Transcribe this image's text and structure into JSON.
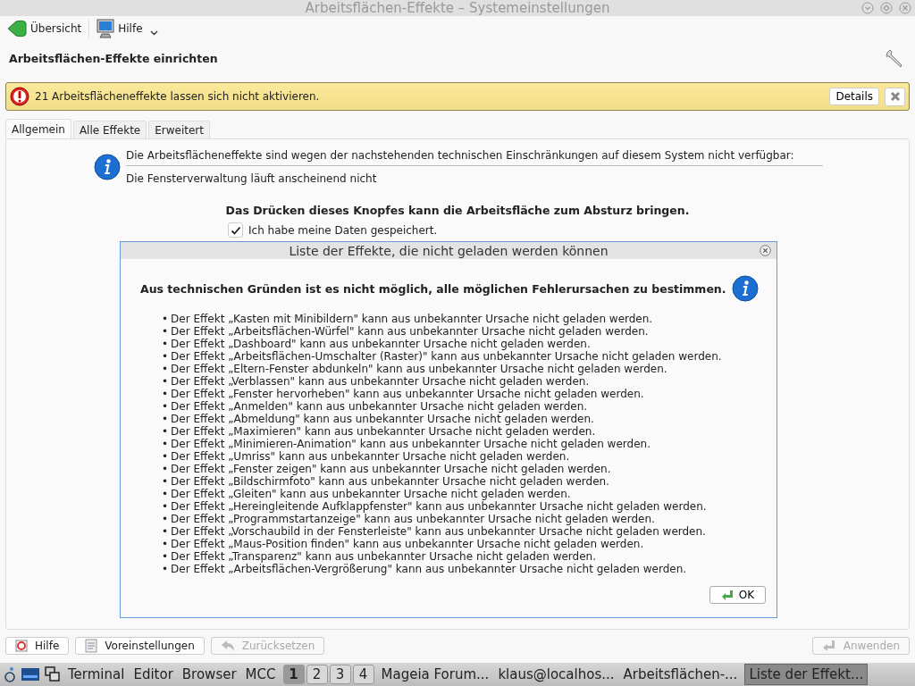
{
  "window": {
    "title": "Arbeitsflächen-Effekte – Systemeinstellungen"
  },
  "toolbar": {
    "items": [
      {
        "kind": "back",
        "label": "Übersicht"
      },
      {
        "kind": "help",
        "label": "Hilfe"
      }
    ]
  },
  "heading": "Arbeitsflächen-Effekte einrichten",
  "banner": {
    "message": "21 Arbeitsflächeneffekte lassen sich nicht aktivieren.",
    "details_button": "Details"
  },
  "tabs": [
    {
      "label": "Allgemein",
      "selected": true
    },
    {
      "label": "Alle Effekte",
      "selected": false
    },
    {
      "label": "Erweitert",
      "selected": false
    }
  ],
  "general": {
    "info_lines": [
      "Die Arbeitsflächeneffekte sind wegen der nachstehenden technischen Einschränkungen auf diesem System nicht verfügbar:",
      "Die Fensterverwaltung läuft anscheinend nicht"
    ],
    "warning": "Das Drücken dieses Knopfes kann die Arbeitsfläche zum Absturz bringen.",
    "confirm": {
      "label": "Ich habe meine Daten gespeichert.",
      "checked": true
    }
  },
  "dialog": {
    "title": "Liste der Effekte, die nicht geladen werden können",
    "heading": "Aus technischen Gründen ist es nicht möglich, alle möglichen Fehlerursachen zu bestimmen.",
    "items": [
      {
        "bullet": "•",
        "text": "Der Effekt „Kasten mit Minibildern\" kann aus unbekannter Ursache nicht geladen werden."
      },
      {
        "bullet": "•",
        "text": "Der Effekt „Arbeitsflächen-Würfel\" kann aus unbekannter Ursache nicht geladen werden."
      },
      {
        "bullet": "•",
        "text": "Der Effekt „Dashboard\" kann aus unbekannter Ursache nicht geladen werden."
      },
      {
        "bullet": "•",
        "text": "Der Effekt „Arbeitsflächen-Umschalter (Raster)\" kann aus unbekannter Ursache nicht geladen werden."
      },
      {
        "bullet": "•",
        "text": "Der Effekt „Eltern-Fenster abdunkeln\" kann aus unbekannter Ursache nicht geladen werden."
      },
      {
        "bullet": "•",
        "text": "Der Effekt „Verblassen\" kann aus unbekannter Ursache nicht geladen werden."
      },
      {
        "bullet": "•",
        "text": "Der Effekt „Fenster hervorheben\" kann aus unbekannter Ursache nicht geladen werden."
      },
      {
        "bullet": "•",
        "text": "Der Effekt „Anmelden\" kann aus unbekannter Ursache nicht geladen werden."
      },
      {
        "bullet": "•",
        "text": "Der Effekt „Abmeldung\" kann aus unbekannter Ursache nicht geladen werden."
      },
      {
        "bullet": "•",
        "text": "Der Effekt „Maximieren\" kann aus unbekannter Ursache nicht geladen werden."
      },
      {
        "bullet": "•",
        "text": "Der Effekt „Minimieren-Animation\" kann aus unbekannter Ursache nicht geladen werden."
      },
      {
        "bullet": "•",
        "text": "Der Effekt „Umriss\" kann aus unbekannter Ursache nicht geladen werden."
      },
      {
        "bullet": "•",
        "text": "Der Effekt „Fenster zeigen\" kann aus unbekannter Ursache nicht geladen werden."
      },
      {
        "bullet": "•",
        "text": "Der Effekt „Bildschirmfoto\" kann aus unbekannter Ursache nicht geladen werden."
      },
      {
        "bullet": "•",
        "text": "Der Effekt „Gleiten\" kann aus unbekannter Ursache nicht geladen werden."
      },
      {
        "bullet": "•",
        "text": "Der Effekt „Hereingleitende Aufklappfenster\" kann aus unbekannter Ursache nicht geladen werden."
      },
      {
        "bullet": "•",
        "text": "Der Effekt „Programmstartanzeige\" kann aus unbekannter Ursache nicht geladen werden."
      },
      {
        "bullet": "•",
        "text": "Der Effekt „Vorschaubild in der Fensterleiste\" kann aus unbekannter Ursache nicht geladen werden."
      },
      {
        "bullet": "•",
        "text": "Der Effekt „Maus-Position finden\" kann aus unbekannter Ursache nicht geladen werden."
      },
      {
        "bullet": "•",
        "text": "Der Effekt „Transparenz\" kann aus unbekannter Ursache nicht geladen werden."
      },
      {
        "bullet": "•",
        "text": "Der Effekt „Arbeitsflächen-Vergrößerung\" kann aus unbekannter Ursache nicht geladen werden."
      }
    ],
    "ok_button": "OK"
  },
  "buttons": [
    {
      "kind": "help",
      "label": "Hilfe",
      "disabled": false
    },
    {
      "kind": "defaults",
      "label": "Voreinstellungen",
      "disabled": false
    },
    {
      "kind": "reset",
      "label": "Zurücksetzen",
      "disabled": true
    },
    {
      "kind": "apply",
      "label": "Anwenden",
      "disabled": true
    }
  ],
  "taskbar": {
    "launchers": [
      "Terminal",
      "Editor",
      "Browser",
      "MCC"
    ],
    "desktops": [
      {
        "label": "1",
        "selected": true
      },
      {
        "label": "2",
        "selected": false
      },
      {
        "label": "3",
        "selected": false
      },
      {
        "label": "4",
        "selected": false
      }
    ],
    "tasks": [
      {
        "label": "Mageia Forum...",
        "selected": false
      },
      {
        "label": "klaus@localhos...",
        "selected": false
      },
      {
        "label": "Arbeitsflächen-...",
        "selected": false
      },
      {
        "label": "Liste der Effekt...",
        "selected": true
      }
    ]
  }
}
